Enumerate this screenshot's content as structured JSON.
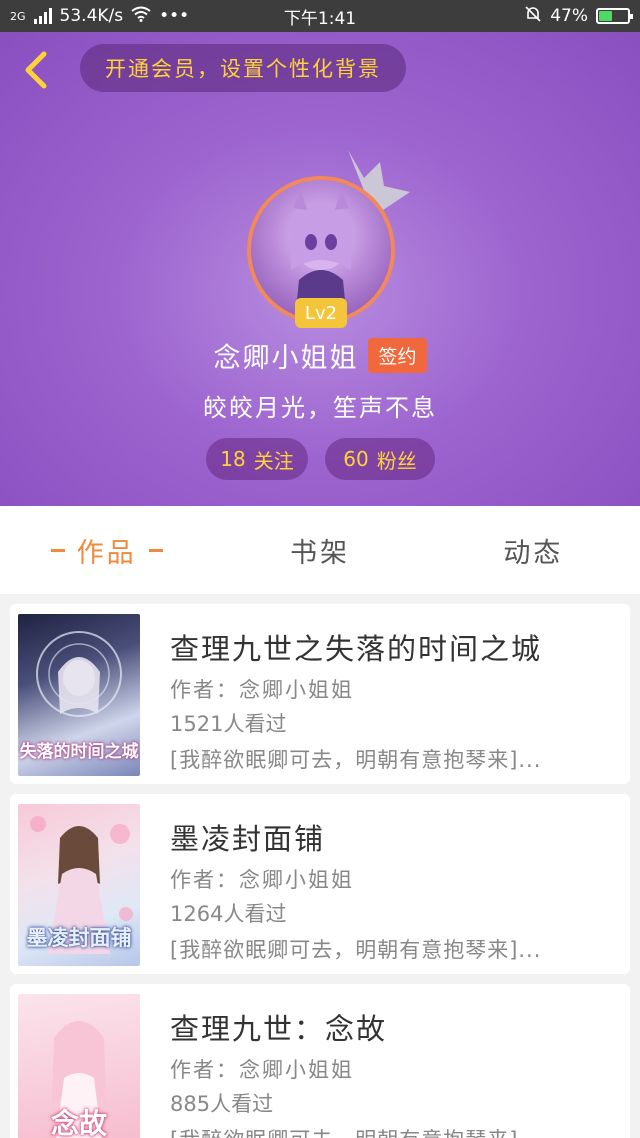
{
  "status_bar": {
    "network_type": "2G",
    "speed": "53.4K/s",
    "more": "•••",
    "time": "下午1:41",
    "battery": "47%",
    "battery_level": 0.47
  },
  "header": {
    "vip_prompt": "开通会员，设置个性化背景",
    "level": "Lv2",
    "username": "念卿小姐姐",
    "signed_badge": "签约",
    "motto": "皎皎月光，笙声不息",
    "follow_count": "18",
    "follow_label": "关注",
    "fans_count": "60",
    "fans_label": "粉丝",
    "colors": {
      "header_bg": "#9d64cf",
      "accent": "#ffd23a",
      "badge": "#f0683b"
    }
  },
  "tabs": [
    {
      "label": "作品",
      "active": true
    },
    {
      "label": "书架",
      "active": false
    },
    {
      "label": "动态",
      "active": false
    }
  ],
  "books": [
    {
      "title": "查理九世之失落的时间之城",
      "cover_title": "失落的时间之城",
      "author": "作者：念卿小姐姐",
      "views": "1521人看过",
      "desc": "[我醉欲眠卿可去，明朝有意抱琴来]..."
    },
    {
      "title": "墨凌封面铺",
      "cover_title": "墨凌封面铺",
      "author": "作者：念卿小姐姐",
      "views": "1264人看过",
      "desc": "[我醉欲眠卿可去，明朝有意抱琴来]..."
    },
    {
      "title": "查理九世：念故",
      "cover_title": "念故",
      "author": "作者：念卿小姐姐",
      "views": "885人看过",
      "desc": "[我醉欲眠卿可去，明朝有意抱琴来]..."
    }
  ]
}
